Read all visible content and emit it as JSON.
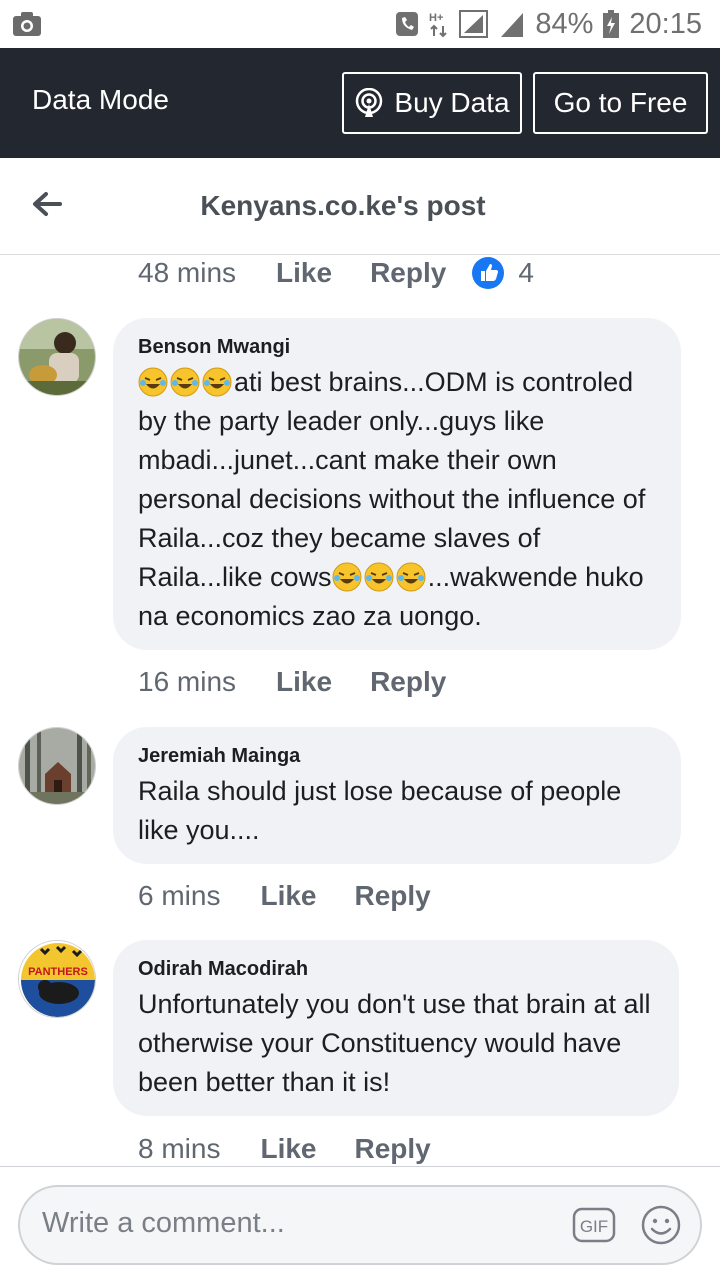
{
  "status_bar": {
    "battery": "84%",
    "time": "20:15",
    "icons": [
      "camera-icon",
      "phone-icon",
      "hplus-data-icon",
      "signal-icon",
      "signal-icon",
      "battery-icon"
    ]
  },
  "data_bar": {
    "title": "Data Mode",
    "buy_label": "Buy Data",
    "free_label": "Go to Free"
  },
  "header": {
    "title": "Kenyans.co.ke's post"
  },
  "top_meta": {
    "time": "48 mins",
    "like": "Like",
    "reply": "Reply",
    "reaction_count": "4"
  },
  "comments": [
    {
      "author": "Benson Mwangi",
      "text_start": "ati best brains...ODM is controled by the party leader only...guys like mbadi...junet...cant make their own personal decisions without the influence of Raila...coz they became slaves of Raila...like cows",
      "text_end": "...wakwende huko na economics zao za uongo.",
      "emoji": "laughing-emoji",
      "time": "16 mins",
      "like": "Like",
      "reply": "Reply"
    },
    {
      "author": "Jeremiah Mainga",
      "text": "Raila should just lose because of people like you....",
      "time": "6 mins",
      "like": "Like",
      "reply": "Reply"
    },
    {
      "author": "Odirah Macodirah",
      "text": "Unfortunately you don't use that brain at all otherwise your Constituency would have been better than it is!",
      "time": "8 mins",
      "like": "Like",
      "reply": "Reply",
      "avatar_text": "PANTHERS"
    }
  ],
  "composer": {
    "placeholder": "Write a comment...",
    "gif_label": "GIF"
  }
}
